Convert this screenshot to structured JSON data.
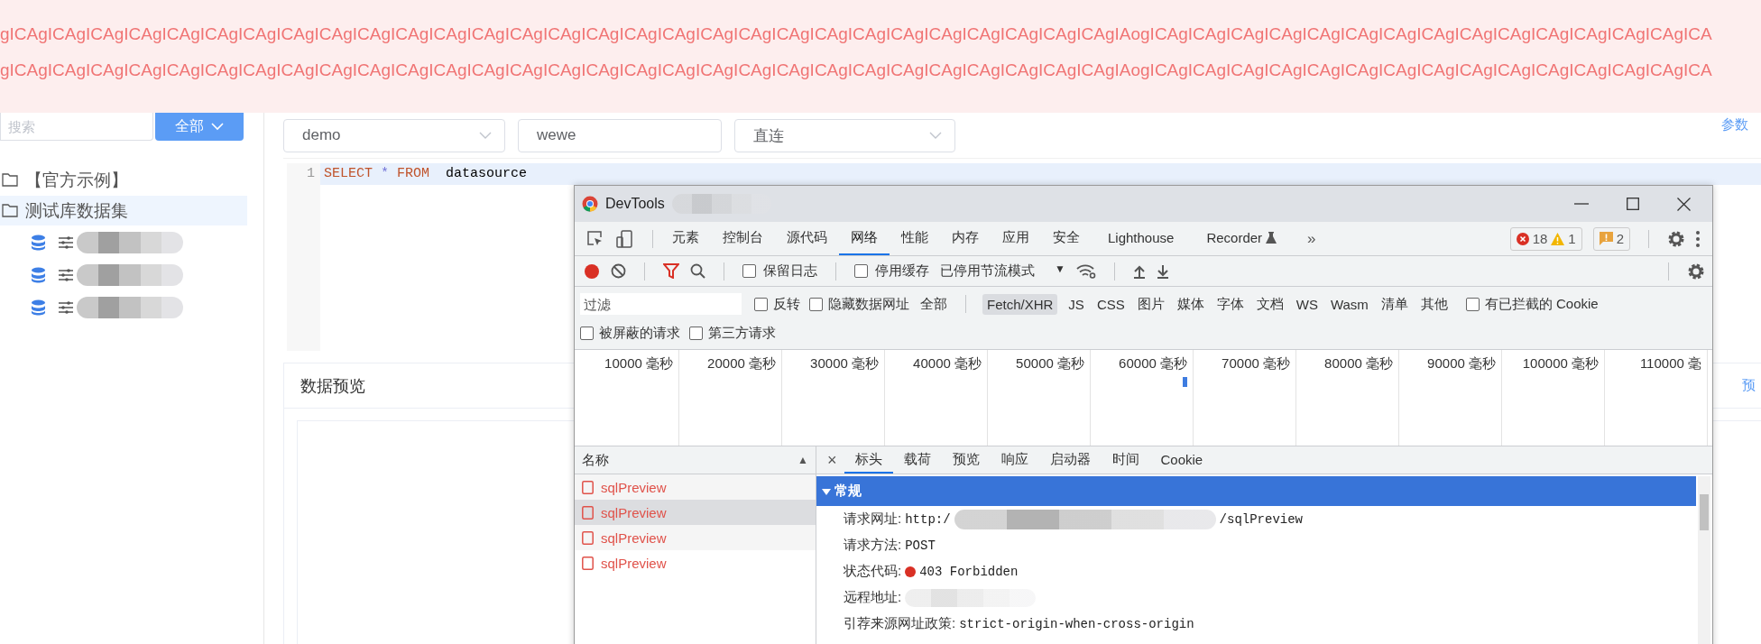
{
  "banner": {
    "lines": [
      "gICAgICAgICAgICAgICAgICAgICAgICAgICAgICAgICAgICAgICAgICAgICAgICAgICAgICAgICAgICAgICAgICAgICAgICAgICAgICAgICAgICAgICAgIAogICAgICAgICAgICAgICAgICAgICAgICAgICAgICAgICAgICAgICAgICAgICA",
      "gICAgICAgICAgICAgICAgICAgICAgICAgICAgICAgICAgICAgICAgICAgICAgICAgICAgICAgICAgICAgICAgICAgICAgICAgICAgICAgICAgICAgICAgIAogICAgICAgICAgICAgICAgICAgICAgICAgICAgICAgICAgICAgICAgICAgICA"
    ]
  },
  "sidebar": {
    "search": {
      "placeholder": "搜索"
    },
    "scope_button": "全部",
    "tree": [
      {
        "label": "【官方示例】",
        "selected": false
      },
      {
        "label": "测试库数据集",
        "selected": true,
        "children": [
          {
            "kind": "dataset"
          },
          {
            "kind": "dataset"
          },
          {
            "kind": "dataset"
          }
        ]
      }
    ]
  },
  "query_form": {
    "fields": [
      {
        "kind": "select",
        "value": "demo"
      },
      {
        "kind": "input",
        "value": "wewe"
      },
      {
        "kind": "select",
        "value": "直连"
      }
    ],
    "link": "参数"
  },
  "editor": {
    "lines": [
      {
        "number": "1",
        "tokens": [
          {
            "kind": "keyword",
            "text": "SELECT"
          },
          {
            "kind": "operator",
            "text": "*"
          },
          {
            "kind": "keyword",
            "text": "FROM"
          },
          {
            "kind": "plain",
            "text": " datasource"
          }
        ]
      }
    ]
  },
  "preview_card": {
    "title": "数据预览",
    "link": "预"
  },
  "devtools": {
    "title": "DevTools",
    "tabs": [
      {
        "label": "元素",
        "selected": false,
        "kind": "panel"
      },
      {
        "label": "控制台",
        "selected": false,
        "kind": "panel"
      },
      {
        "label": "源代码",
        "selected": false,
        "kind": "panel"
      },
      {
        "label": "网络",
        "selected": true,
        "kind": "panel"
      },
      {
        "label": "性能",
        "selected": false,
        "kind": "panel"
      },
      {
        "label": "内存",
        "selected": false,
        "kind": "panel"
      },
      {
        "label": "应用",
        "selected": false,
        "kind": "panel"
      },
      {
        "label": "安全",
        "selected": false,
        "kind": "panel"
      },
      {
        "label": "Lighthouse",
        "selected": false,
        "kind": "panel"
      },
      {
        "label": "Recorder",
        "selected": false,
        "kind": "experimental"
      }
    ],
    "more_tabs": "»",
    "counts": {
      "errors": "18",
      "warnings": "1",
      "issues": "2"
    },
    "toolbar": {
      "recording": true,
      "checkboxes": [
        {
          "label": "保留日志",
          "checked": false
        },
        {
          "label": "停用缓存",
          "checked": false
        }
      ],
      "throttling": "已停用节流模式",
      "throttling_caret": "▼"
    },
    "filter": {
      "placeholder": "过滤",
      "checkboxes": [
        {
          "label": "反转",
          "checked": false
        },
        {
          "label": "隐藏数据网址",
          "checked": false
        }
      ],
      "types": [
        {
          "label": "全部",
          "selected": false
        },
        {
          "label": "Fetch/XHR",
          "selected": true
        },
        {
          "label": "JS",
          "selected": false
        },
        {
          "label": "CSS",
          "selected": false
        },
        {
          "label": "图片",
          "selected": false
        },
        {
          "label": "媒体",
          "selected": false
        },
        {
          "label": "字体",
          "selected": false
        },
        {
          "label": "文档",
          "selected": false
        },
        {
          "label": "WS",
          "selected": false
        },
        {
          "label": "Wasm",
          "selected": false
        },
        {
          "label": "清单",
          "selected": false
        },
        {
          "label": "其他",
          "selected": false
        }
      ],
      "cookie_checkbox": {
        "label": "有已拦截的 Cookie",
        "checked": false
      },
      "extra_checkboxes": [
        {
          "label": "被屏蔽的请求",
          "checked": false
        },
        {
          "label": "第三方请求",
          "checked": false
        }
      ]
    },
    "timeline": {
      "ticks": [
        "10000 毫秒",
        "20000 毫秒",
        "30000 毫秒",
        "40000 毫秒",
        "50000 毫秒",
        "60000 毫秒",
        "70000 毫秒",
        "80000 毫秒",
        "90000 毫秒",
        "100000 毫秒",
        "110000 毫"
      ]
    },
    "requests": {
      "header": "名称",
      "sort": "▲",
      "rows": [
        {
          "name": "sqlPreview",
          "failed": true,
          "selected": false
        },
        {
          "name": "sqlPreview",
          "failed": true,
          "selected": true
        },
        {
          "name": "sqlPreview",
          "failed": true,
          "selected": false
        },
        {
          "name": "sqlPreview",
          "failed": true,
          "selected": false
        }
      ]
    },
    "detail": {
      "close": "×",
      "tabs": [
        {
          "label": "标头",
          "selected": true
        },
        {
          "label": "载荷",
          "selected": false
        },
        {
          "label": "预览",
          "selected": false
        },
        {
          "label": "响应",
          "selected": false
        },
        {
          "label": "启动器",
          "selected": false
        },
        {
          "label": "时间",
          "selected": false
        },
        {
          "label": "Cookie",
          "selected": false
        }
      ],
      "section": {
        "title": "常规",
        "expanded": true,
        "rows": [
          {
            "label": "请求网址:",
            "parts": [
              {
                "kind": "text",
                "text": "http:/"
              },
              {
                "kind": "redacted"
              },
              {
                "kind": "text",
                "text": "/sqlPreview"
              }
            ]
          },
          {
            "label": "请求方法:",
            "parts": [
              {
                "kind": "text",
                "text": "POST"
              }
            ]
          },
          {
            "label": "状态代码:",
            "parts": [
              {
                "kind": "status",
                "text": "403 Forbidden"
              }
            ]
          },
          {
            "label": "远程地址:",
            "parts": [
              {
                "kind": "hidden"
              }
            ]
          },
          {
            "label": "引荐来源网址政策:",
            "parts": [
              {
                "kind": "text",
                "text": "strict-origin-when-cross-origin"
              }
            ]
          }
        ]
      }
    }
  }
}
